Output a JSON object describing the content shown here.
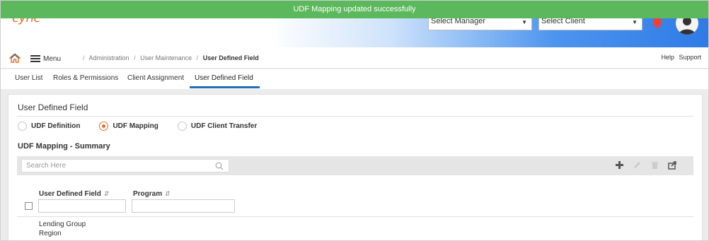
{
  "notification": "UDF Mapping updated successfully",
  "header": {
    "logo_text": "cync",
    "manager_select": "Select Manager",
    "client_select": "Select Client"
  },
  "nav": {
    "menu_label": "Menu",
    "breadcrumb": [
      "Administration",
      "User Maintenance",
      "User Defined Field"
    ],
    "help": "Help",
    "support": "Support"
  },
  "tabs": [
    "User List",
    "Roles & Permissions",
    "Client Assignment",
    "User Defined Field"
  ],
  "main": {
    "title": "User Defined Field",
    "radio_options": [
      "UDF Definition",
      "UDF Mapping",
      "UDF Client Transfer"
    ],
    "selected_radio": "UDF Mapping",
    "summary_title": "UDF Mapping - Summary",
    "search_placeholder": "Search Here",
    "columns": [
      "User Defined Field",
      "Program"
    ],
    "rows": [
      "Lending Group",
      "Region"
    ]
  },
  "colors": {
    "success": "#5cb85c",
    "accent_orange": "#e2712b",
    "tab_active": "#1f6fb7"
  },
  "icons": [
    "home-icon",
    "hamburger-icon",
    "bell-icon",
    "avatar-icon",
    "search-icon",
    "plus-icon",
    "pencil-icon",
    "trash-icon",
    "export-icon",
    "sort-icon"
  ]
}
